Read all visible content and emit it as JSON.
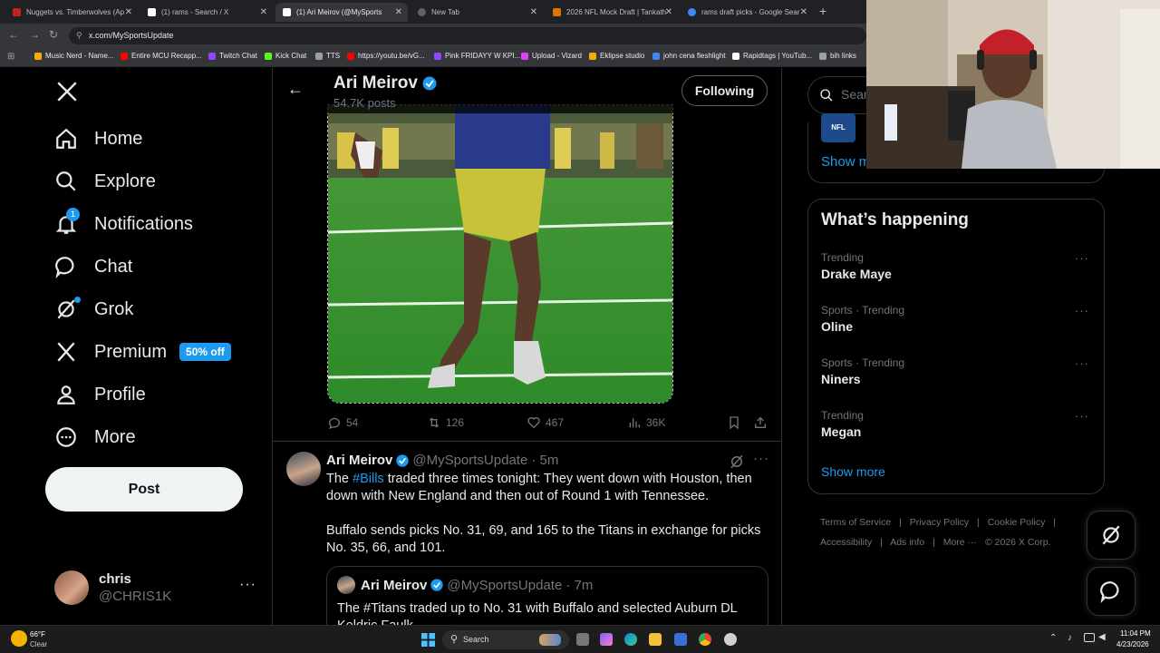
{
  "browser": {
    "tabs": [
      {
        "title": "Nuggets vs. Timberwolves (Ap",
        "color": "#c5221f"
      },
      {
        "title": "(1) rams - Search / X",
        "color": "#000000"
      },
      {
        "title": "(1) Ari Meirov (@MySports",
        "color": "#000000"
      },
      {
        "title": "New Tab",
        "color": "#5f6368"
      },
      {
        "title": "2026 NFL Mock Draft | Tankath",
        "color": "#e37400"
      },
      {
        "title": "rams draft picks - Google Sear",
        "color": "#4285f4"
      }
    ],
    "url": "x.com/MySportsUpdate",
    "bookmarks": [
      {
        "label": "Music Nerd - Name...",
        "color": "#f9ab00"
      },
      {
        "label": "Entire MCU Recapp...",
        "color": "#ff0000"
      },
      {
        "label": "Twitch Chat",
        "color": "#9146ff"
      },
      {
        "label": "Kick Chat",
        "color": "#53fc18"
      },
      {
        "label": "TTS",
        "color": "#9aa0a6"
      },
      {
        "label": "https://youtu.be/vG...",
        "color": "#ff0000"
      },
      {
        "label": "Pink FRIDAYY W KPI...",
        "color": "#9146ff"
      },
      {
        "label": "Upload - Vizard",
        "color": "#e040fb"
      },
      {
        "label": "Eklipse studio",
        "color": "#f9ab00"
      },
      {
        "label": "john cena fleshlight",
        "color": "#4285f4"
      },
      {
        "label": "Rapidtags | YouTub...",
        "color": "#ffffff"
      },
      {
        "label": "bih links",
        "color": "#9aa0a6"
      }
    ]
  },
  "nav": {
    "items": [
      {
        "label": "Home",
        "icon": "home-icon"
      },
      {
        "label": "Explore",
        "icon": "search-icon"
      },
      {
        "label": "Notifications",
        "icon": "bell-icon",
        "badge": "1"
      },
      {
        "label": "Chat",
        "icon": "chat-icon"
      },
      {
        "label": "Grok",
        "icon": "grok-icon"
      },
      {
        "label": "Premium",
        "icon": "x-logo-icon",
        "badge": "50% off"
      },
      {
        "label": "Profile",
        "icon": "profile-icon"
      },
      {
        "label": "More",
        "icon": "more-circle-icon"
      }
    ],
    "post_label": "Post",
    "account": {
      "name": "chris",
      "handle": "@CHRIS1K"
    }
  },
  "header": {
    "name": "Ari Meirov",
    "posts": "54.7K posts",
    "following_label": "Following"
  },
  "tweet1": {
    "replies": "54",
    "retweets": "126",
    "likes": "467",
    "views": "36K"
  },
  "tweet2": {
    "name": "Ari Meirov",
    "handle": "@MySportsUpdate",
    "time": "· 5m",
    "text_pre": "The ",
    "hashtag": "#Bills",
    "text_post": " traded three times tonight: They went down with Houston, then down with New England and then out of Round 1 with Tennessee.",
    "text2": "Buffalo sends picks No. 31, 69, and 165 to the Titans in exchange for picks No. 35, 66, and 101.",
    "quote": {
      "name": "Ari Meirov",
      "handle": "@MySportsUpdate",
      "time": "· 7m",
      "text": "The #Titans traded up to No. 31 with Buffalo and selected Auburn DL",
      "text_cut": "Keldric Faulk"
    }
  },
  "sidebar": {
    "search_placeholder": "Search",
    "badge_text": "NFL",
    "show_more_top": "Show more",
    "whats_happening": "What’s happening",
    "trends": [
      {
        "category": "Trending",
        "title": "Drake Maye"
      },
      {
        "category": "Sports · Trending",
        "title": "Oline"
      },
      {
        "category": "Sports · Trending",
        "title": "Niners"
      },
      {
        "category": "Trending",
        "title": "Megan"
      }
    ],
    "show_more": "Show more",
    "footer": {
      "terms": "Terms of Service",
      "privacy": "Privacy Policy",
      "cookie": "Cookie Policy",
      "accessibility": "Accessibility",
      "ads": "Ads info",
      "more": "More ···",
      "copyright": "© 2026 X Corp."
    }
  },
  "taskbar": {
    "temp": "66°F",
    "condition": "Clear",
    "search": "Search",
    "time": "11:04 PM",
    "date": "4/23/2026"
  }
}
